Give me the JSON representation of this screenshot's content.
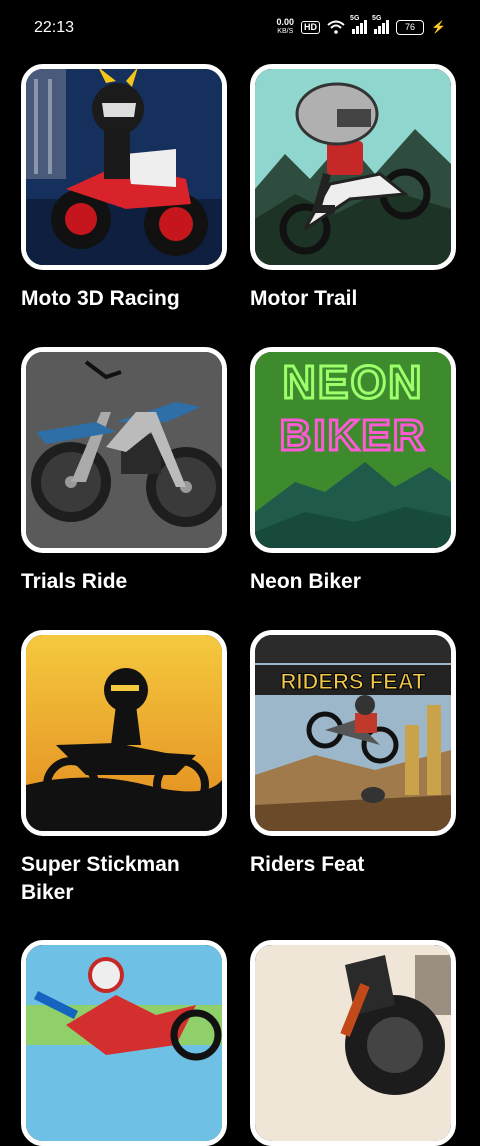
{
  "status_bar": {
    "time": "22:13",
    "net_speed_value": "0.00",
    "net_speed_unit": "KB/S",
    "hd_badge": "HD",
    "sim_label": "5G",
    "battery": "76"
  },
  "games": [
    {
      "title": "Moto 3D Racing",
      "icon": "moto-3d-racing-thumbnail"
    },
    {
      "title": "Motor Trail",
      "icon": "motor-trail-thumbnail"
    },
    {
      "title": "Trials Ride",
      "icon": "trials-ride-thumbnail"
    },
    {
      "title": "Neon Biker",
      "icon": "neon-biker-thumbnail",
      "art_text_1": "NEON",
      "art_text_2": "BIKER"
    },
    {
      "title": "Super Stickman Biker",
      "icon": "super-stickman-biker-thumbnail"
    },
    {
      "title": "Riders Feat",
      "icon": "riders-feat-thumbnail",
      "art_text": "RIDERS FEAT"
    },
    {
      "title": "",
      "icon": "motocross-game-thumbnail"
    },
    {
      "title": "",
      "icon": "dirt-bike-game-thumbnail"
    }
  ]
}
